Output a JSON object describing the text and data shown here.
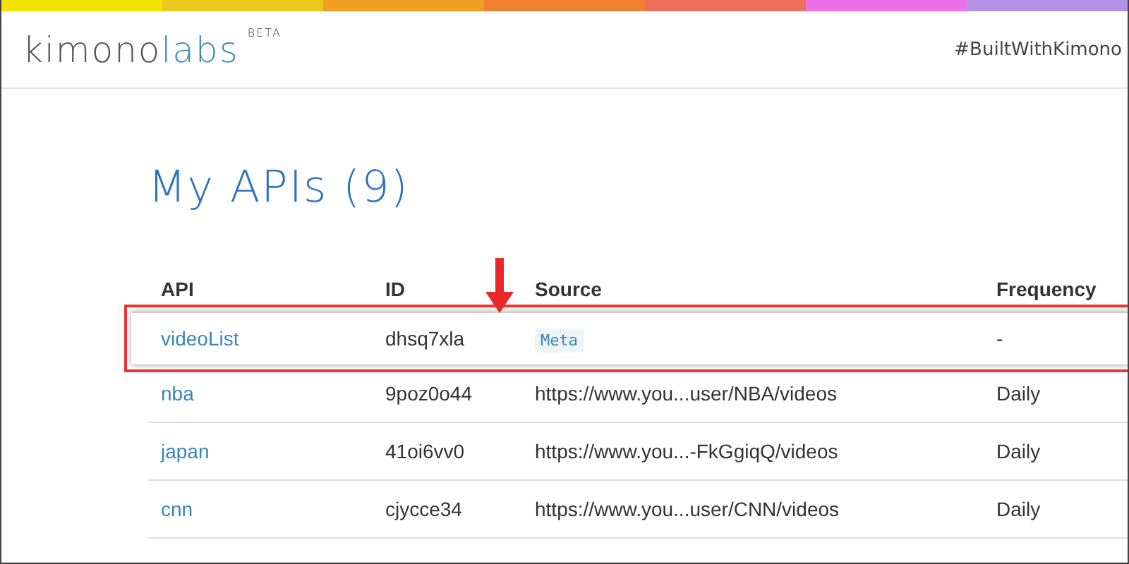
{
  "header": {
    "logo_dark": "kimono",
    "logo_light": "labs",
    "badge": "BETA",
    "hashtag": "#BuiltWithKimono"
  },
  "color_bar": [
    {
      "color": "#f2e400"
    },
    {
      "color": "#ecc81a"
    },
    {
      "color": "#efa020"
    },
    {
      "color": "#ef8030"
    },
    {
      "color": "#ee6e5c"
    },
    {
      "color": "#ea70e8"
    },
    {
      "color": "#b490e6"
    }
  ],
  "title": "My APIs (9)",
  "table": {
    "columns": [
      "API",
      "ID",
      "Source",
      "Frequency"
    ],
    "rows": [
      {
        "api": "videoList",
        "id": "dhsq7xla",
        "source": "Meta",
        "kind": "badge",
        "frequency": "-",
        "highlighted": true
      },
      {
        "api": "nba",
        "id": "9poz0o44",
        "source": "https://www.you...user/NBA/videos",
        "kind": "text",
        "frequency": "Daily",
        "highlighted": false
      },
      {
        "api": "japan",
        "id": "41oi6vv0",
        "source": "https://www.you...-FkGgiqQ/videos",
        "kind": "text",
        "frequency": "Daily",
        "highlighted": false
      },
      {
        "api": "cnn",
        "id": "cjycce34",
        "source": "https://www.you...user/CNN/videos",
        "kind": "text",
        "frequency": "Daily",
        "highlighted": false
      }
    ]
  }
}
